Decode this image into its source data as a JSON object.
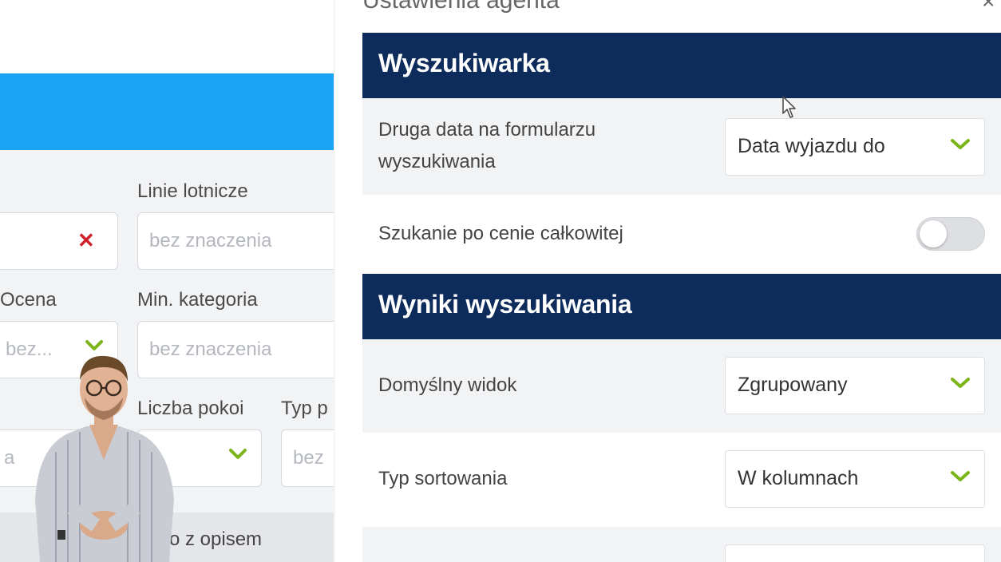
{
  "left_form": {
    "label_airlines": "Linie lotnicze",
    "label_rating": "Ocena",
    "label_min_category": "Min. kategoria",
    "label_rooms": "Liczba pokoi",
    "label_type": "Typ p",
    "placeholder_airlines": "bez znaczenia",
    "placeholder_rating": "bez...",
    "placeholder_min_category": "bez znaczenia",
    "placeholder_type": "bez",
    "partial_value": "a",
    "only_with_description": "ko z opisem",
    "clear_icon": "close-icon",
    "accent_color": "#1aa3f5"
  },
  "panel": {
    "title": "Ustawienia agenta",
    "close_glyph": "×",
    "sections": {
      "search": {
        "heading": "Wyszukiwarka",
        "second_date_label_line1": "Druga data na formularzu",
        "second_date_label_line2": "wyszukiwania",
        "second_date_value": "Data wyjazdu do",
        "total_price_label": "Szukanie po cenie całkowitej",
        "total_price_enabled": false
      },
      "results": {
        "heading": "Wyniki wyszukiwania",
        "default_view_label": "Domyślny widok",
        "default_view_value": "Zgrupowany",
        "sort_type_label": "Typ sortowania",
        "sort_type_value": "W kolumnach"
      }
    }
  },
  "colors": {
    "section_header_bg": "#0d2b5b",
    "chevron_green": "#7cb518",
    "clear_red": "#d0202a"
  }
}
